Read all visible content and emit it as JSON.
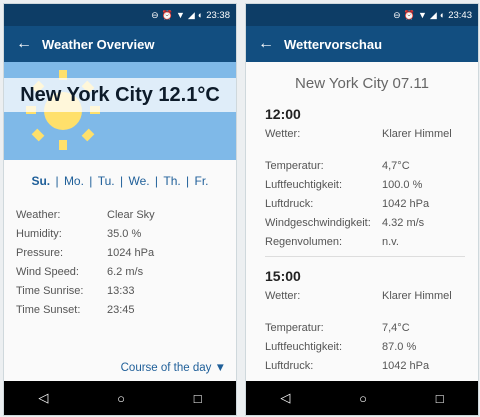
{
  "left": {
    "status": {
      "time": "23:38"
    },
    "appbar": {
      "title": "Weather Overview"
    },
    "hero": {
      "city_temp": "New York City 12.1°C"
    },
    "days": [
      "Su.",
      "Mo.",
      "Tu.",
      "We.",
      "Th.",
      "Fr."
    ],
    "active_day": "Su.",
    "details": [
      {
        "label": "Weather:",
        "value": "Clear Sky"
      },
      {
        "label": "Humidity:",
        "value": "35.0 %"
      },
      {
        "label": "Pressure:",
        "value": "1024 hPa"
      },
      {
        "label": "Wind Speed:",
        "value": "6.2 m/s"
      },
      {
        "label": "Time Sunrise:",
        "value": "13:33"
      },
      {
        "label": "Time Sunset:",
        "value": "23:45"
      }
    ],
    "course_label": "Course of the day",
    "course_icon": "▼"
  },
  "right": {
    "status": {
      "time": "23:43"
    },
    "appbar": {
      "title": "Wettervorschau"
    },
    "city_date": "New York City 07.11",
    "blocks": [
      {
        "time": "12:00",
        "rows": [
          {
            "label": "Wetter:",
            "value": "Klarer Himmel"
          },
          {
            "label": "Temperatur:",
            "value": "4,7°C"
          },
          {
            "label": "Luftfeuchtigkeit:",
            "value": "100.0 %"
          },
          {
            "label": "Luftdruck:",
            "value": "1042 hPa"
          },
          {
            "label": "Windgeschwindigkeit:",
            "value": "4.32 m/s"
          },
          {
            "label": "Regenvolumen:",
            "value": "n.v."
          }
        ]
      },
      {
        "time": "15:00",
        "rows": [
          {
            "label": "Wetter:",
            "value": "Klarer Himmel"
          },
          {
            "label": "Temperatur:",
            "value": "7,4°C"
          },
          {
            "label": "Luftfeuchtigkeit:",
            "value": "87.0 %"
          },
          {
            "label": "Luftdruck:",
            "value": "1042 hPa"
          }
        ]
      }
    ]
  },
  "icons": {
    "back": "back-arrow-icon",
    "nav_back": "nav-back-icon",
    "nav_home": "nav-home-icon",
    "nav_recent": "nav-recent-icon"
  },
  "colors": {
    "appbar": "#124e80",
    "statusbar": "#0d3d66",
    "accent": "#1f5f99",
    "sky": "#7fb9e8",
    "sun": "#ffe06b"
  }
}
